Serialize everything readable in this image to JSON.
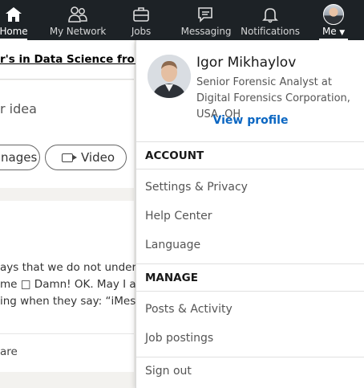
{
  "nav": {
    "items": [
      {
        "label": "Home",
        "icon": "home-icon",
        "active": true
      },
      {
        "label": "My Network",
        "icon": "network-icon"
      },
      {
        "label": "Jobs",
        "icon": "briefcase-icon"
      },
      {
        "label": "Messaging",
        "icon": "messaging-icon"
      },
      {
        "label": "Notifications",
        "icon": "bell-icon"
      },
      {
        "label": "Me",
        "icon": "avatar"
      }
    ]
  },
  "feed": {
    "headline": "r's in Data Science from",
    "share_prompt": "r idea",
    "images_label": "nages",
    "video_label": "Video",
    "post_lines": [
      "ays that we do not understa",
      "me □ Damn! OK. May I ask",
      "ing when they say: “iMessag"
    ],
    "share_label": "are"
  },
  "dropdown": {
    "profile": {
      "name": "Igor Mikhaylov",
      "headline": "Senior Forensic Analyst at Digital Forensics Corporation, USA, OH",
      "view_profile": "View profile"
    },
    "account": {
      "heading": "ACCOUNT",
      "items": [
        "Settings & Privacy",
        "Help Center",
        "Language"
      ]
    },
    "manage": {
      "heading": "MANAGE",
      "items": [
        "Posts & Activity",
        "Job postings"
      ]
    },
    "sign_out": "Sign out"
  },
  "colors": {
    "nav_bg": "#1d2226",
    "link_blue": "#0a66c2",
    "page_bg": "#f3f2ef"
  }
}
